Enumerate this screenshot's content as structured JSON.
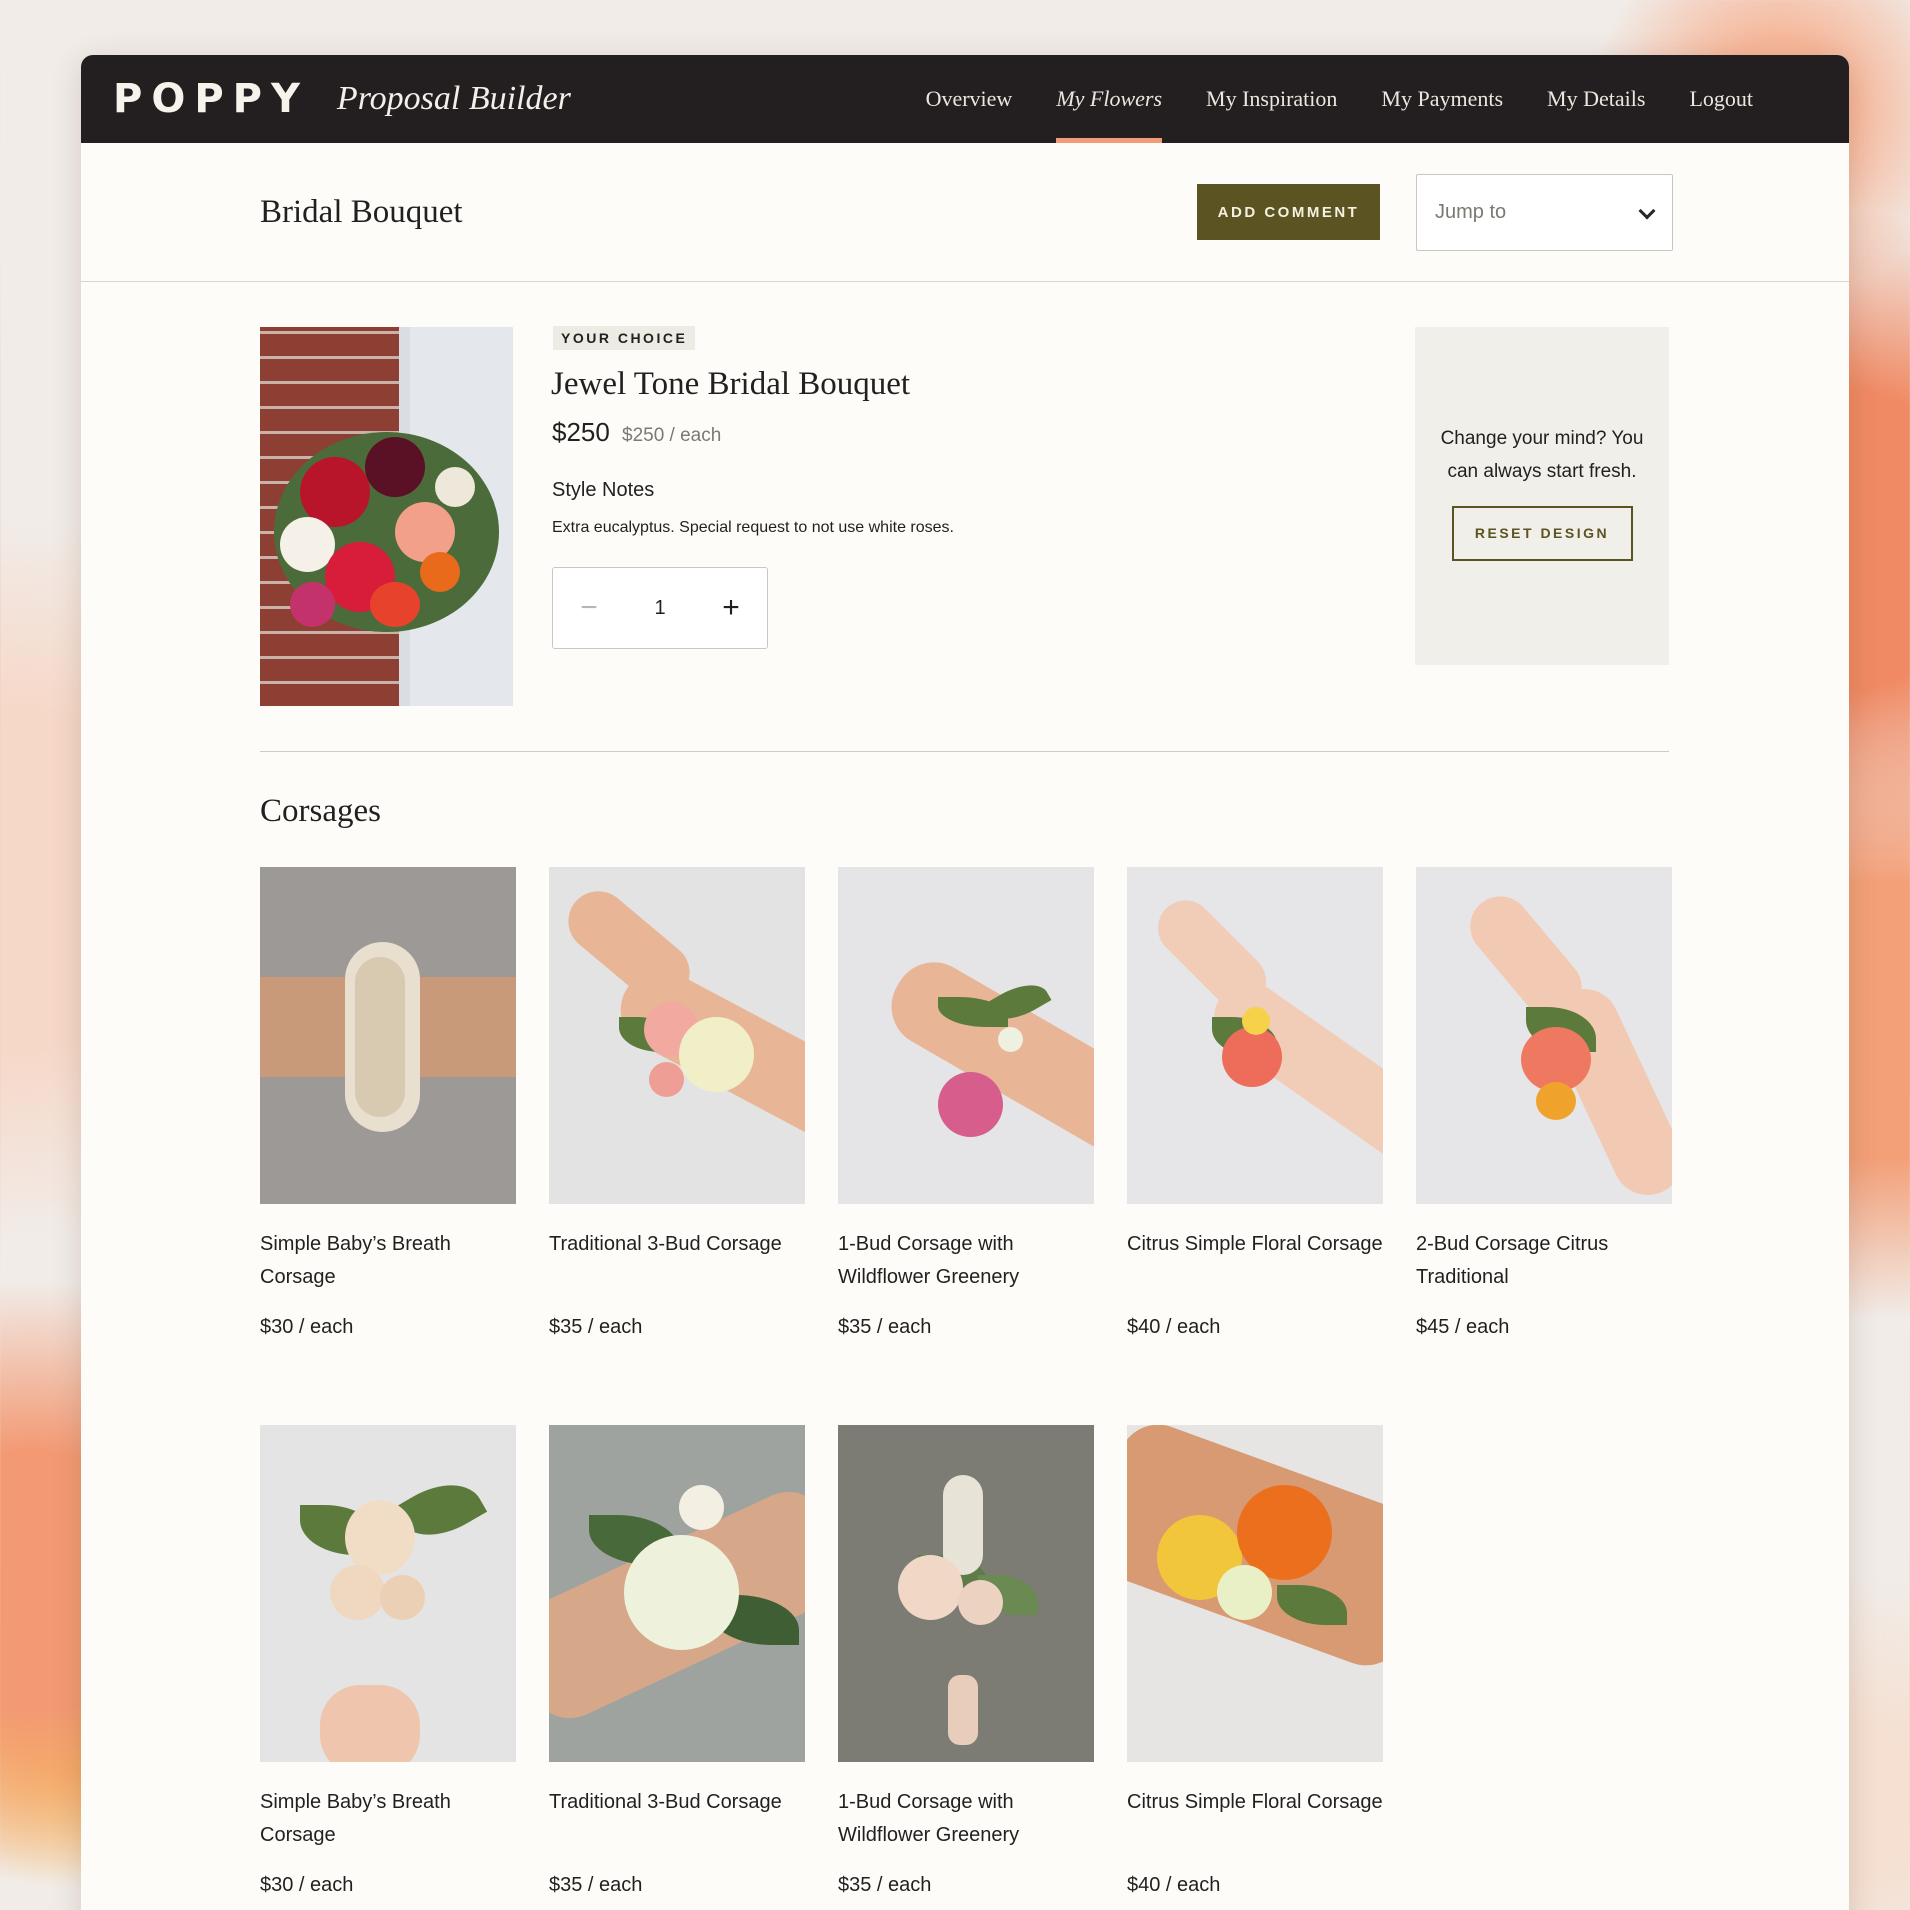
{
  "app": {
    "logo": "POPPY",
    "subtitle": "Proposal Builder"
  },
  "nav": {
    "items": [
      {
        "label": "Overview"
      },
      {
        "label": "My Flowers"
      },
      {
        "label": "My Inspiration"
      },
      {
        "label": "My Payments"
      },
      {
        "label": "My Details"
      },
      {
        "label": "Logout"
      }
    ],
    "active": "My Flowers"
  },
  "section": {
    "title": "Bridal Bouquet",
    "add_comment_label": "Add Comment",
    "jump_placeholder": "Jump to"
  },
  "choice": {
    "tag": "Your Choice",
    "name": "Jewel Tone Bridal Bouquet",
    "price": "$250",
    "price_each": "$250 / each",
    "notes_label": "Style Notes",
    "notes": "Extra eucalyptus. Special request to not use white roses.",
    "quantity": "1",
    "minus": "−",
    "plus": "+"
  },
  "reset": {
    "text": "Change your mind? You can always start fresh.",
    "button_label": "Reset Design"
  },
  "corsages": {
    "title": "Corsages",
    "items": [
      {
        "name": "Simple Baby’s Breath Corsage",
        "price": "$30 / each"
      },
      {
        "name": "Traditional 3-Bud Corsage",
        "price": "$35 / each"
      },
      {
        "name": "1-Bud Corsage with Wildflower Greenery",
        "price": "$35 / each"
      },
      {
        "name": "Citrus Simple Floral Corsage",
        "price": "$40 / each"
      },
      {
        "name": "2-Bud Corsage Citrus Traditional",
        "price": "$45 / each"
      },
      {
        "name": "Simple Baby’s Breath Corsage",
        "price": "$30 / each"
      },
      {
        "name": "Traditional 3-Bud Corsage",
        "price": "$35 / each"
      },
      {
        "name": "1-Bud Corsage with Wildflower Greenery",
        "price": "$35 / each"
      },
      {
        "name": "Citrus Simple Floral Corsage",
        "price": "$40 / each"
      }
    ]
  },
  "colors": {
    "topbar": "#231f20",
    "accent_olive": "#5b5321",
    "nav_underline": "#f19a7a",
    "panel": "#f0efe9"
  }
}
